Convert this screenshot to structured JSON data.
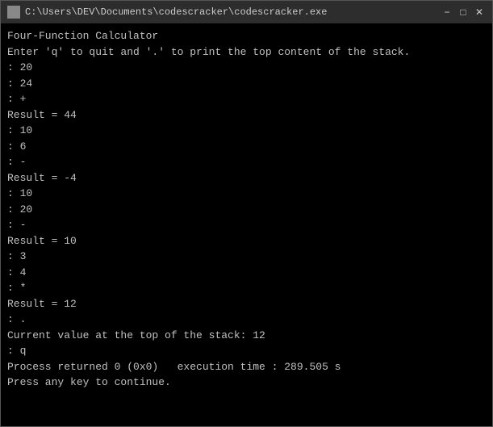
{
  "titleBar": {
    "path": "C:\\Users\\DEV\\Documents\\codescracker\\codescracker.exe",
    "minimizeLabel": "−",
    "maximizeLabel": "□",
    "closeLabel": "✕"
  },
  "console": {
    "lines": [
      "Four-Function Calculator",
      "Enter 'q' to quit and '.' to print the top content of the stack.",
      ": 20",
      ": 24",
      ": +",
      "Result = 44",
      ": 10",
      ": 6",
      ": -",
      "Result = -4",
      ": 10",
      ": 20",
      ": -",
      "Result = 10",
      ": 3",
      ": 4",
      ": *",
      "Result = 12",
      ": .",
      "Current value at the top of the stack: 12",
      ": q",
      "",
      "Process returned 0 (0x0)   execution time : 289.505 s",
      "Press any key to continue."
    ]
  }
}
